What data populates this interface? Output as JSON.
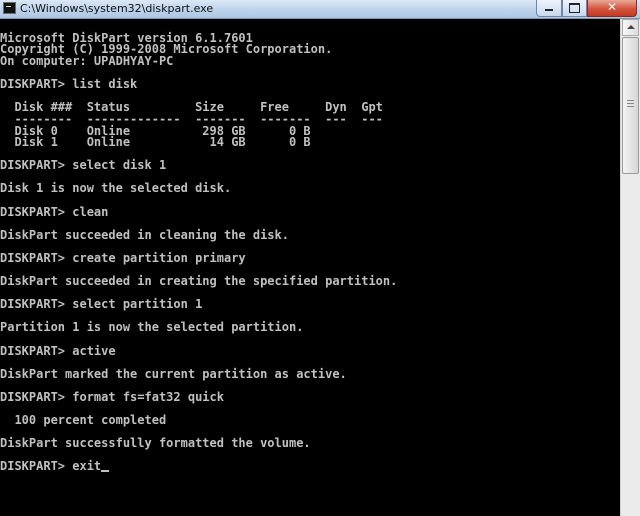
{
  "window": {
    "title": "C:\\Windows\\system32\\diskpart.exe",
    "minimize_icon": "minimize-icon",
    "maximize_icon": "maximize-icon",
    "close_icon": "close-icon",
    "close_label": "✕"
  },
  "console": {
    "lines": [
      "Microsoft DiskPart version 6.1.7601",
      "Copyright (C) 1999-2008 Microsoft Corporation.",
      "On computer: UPADHYAY-PC",
      "DISKPART> list disk",
      "  Disk ###  Status         Size     Free     Dyn  Gpt",
      "  --------  -------------  -------  -------  ---  ---",
      "  Disk 0    Online          298 GB      0 B",
      "  Disk 1    Online           14 GB      0 B",
      "DISKPART> select disk 1",
      "Disk 1 is now the selected disk.",
      "DISKPART> clean",
      "DiskPart succeeded in cleaning the disk.",
      "DISKPART> create partition primary",
      "DiskPart succeeded in creating the specified partition.",
      "DISKPART> select partition 1",
      "Partition 1 is now the selected partition.",
      "DISKPART> active",
      "DiskPart marked the current partition as active.",
      "DISKPART> format fs=fat32 quick",
      "  100 percent completed",
      "DiskPart successfully formatted the volume.",
      "DISKPART> exit"
    ]
  },
  "colors": {
    "console_background": "#000000",
    "console_text": "#c0c0c0",
    "close_button": "#c94a33"
  }
}
